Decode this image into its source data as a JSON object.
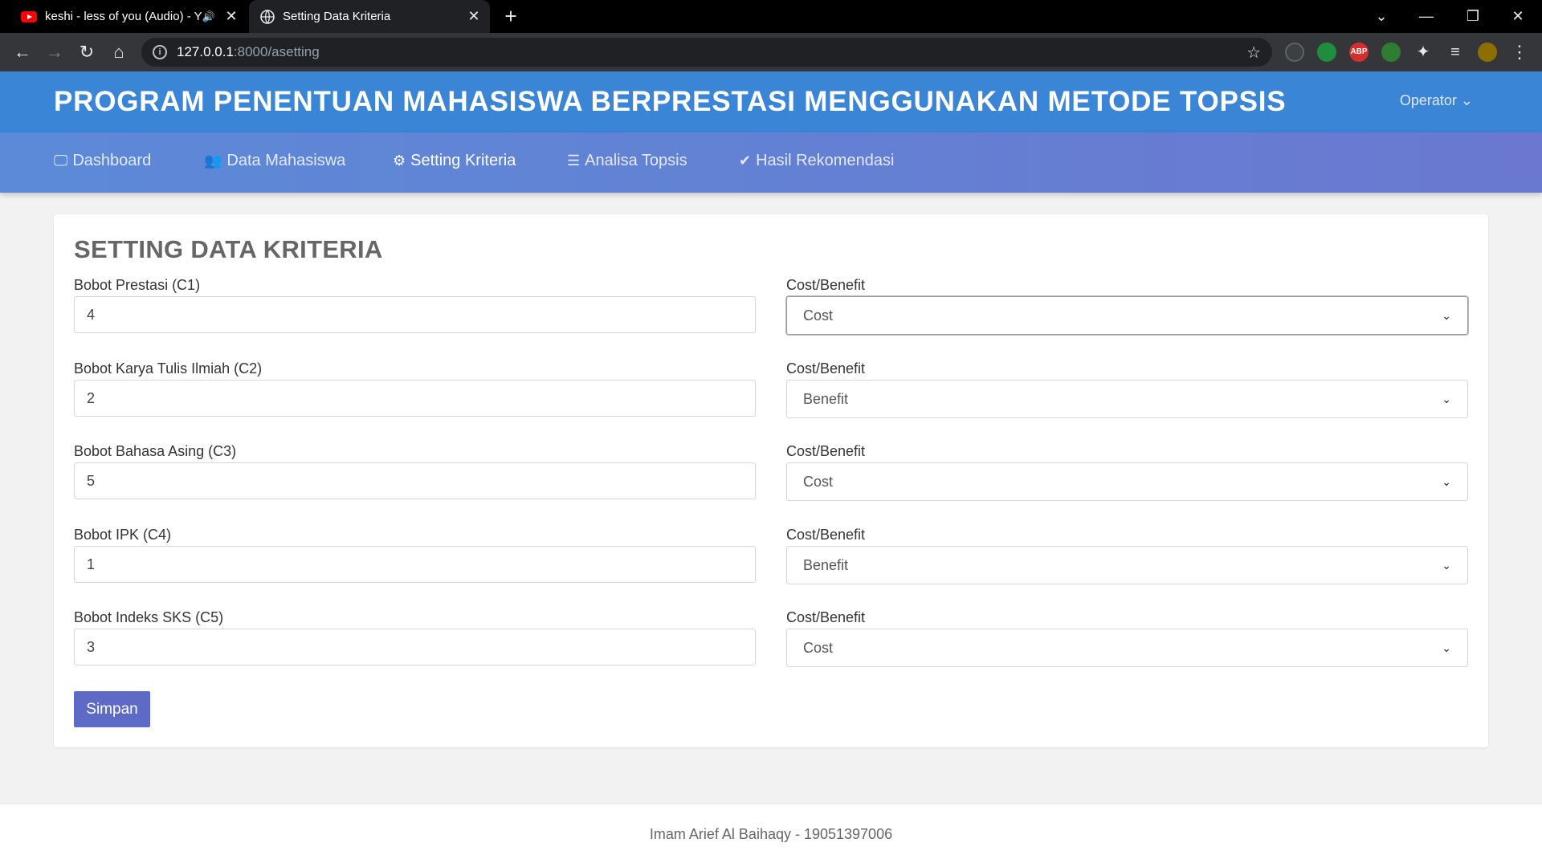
{
  "browser": {
    "tabs": [
      {
        "title": "keshi - less of you (Audio) - Y",
        "close": "✕",
        "audio": "🔊"
      },
      {
        "title": "Setting Data Kriteria",
        "close": "✕"
      }
    ],
    "new_tab": "+",
    "url_host": "127.0.0.1",
    "url_path": ":8000/asetting",
    "icons": [
      "back-icon",
      "forward-icon",
      "reload-icon",
      "home-icon",
      "info-icon",
      "star-icon",
      "extensions-icon",
      "menu-icon"
    ],
    "extensions": {
      "abp": "ABP"
    },
    "window_controls": {
      "tab_search": "⌄",
      "minimize": "—",
      "restore": "❐",
      "close": "✕"
    }
  },
  "header": {
    "title": "PROGRAM PENENTUAN MAHASISWA BERPRESTASI MENGGUNAKAN METODE TOPSIS",
    "user_menu": "Operator"
  },
  "nav": {
    "items": [
      {
        "label": "Dashboard",
        "icon": "monitor-icon"
      },
      {
        "label": "Data Mahasiswa",
        "icon": "users-icon"
      },
      {
        "label": "Setting Kriteria",
        "icon": "gear-icon",
        "active": true
      },
      {
        "label": "Analisa Topsis",
        "icon": "list-icon"
      },
      {
        "label": "Hasil Rekomendasi",
        "icon": "check-icon"
      }
    ]
  },
  "form": {
    "title": "SETTING DATA KRITERIA",
    "rows": [
      {
        "label": "Bobot Prestasi (C1)",
        "value": "4",
        "type_label": "Cost/Benefit",
        "type_value": "Cost"
      },
      {
        "label": "Bobot Karya Tulis Ilmiah (C2)",
        "value": "2",
        "type_label": "Cost/Benefit",
        "type_value": "Benefit"
      },
      {
        "label": "Bobot Bahasa Asing (C3)",
        "value": "5",
        "type_label": "Cost/Benefit",
        "type_value": "Cost"
      },
      {
        "label": "Bobot IPK (C4)",
        "value": "1",
        "type_label": "Cost/Benefit",
        "type_value": "Benefit"
      },
      {
        "label": "Bobot Indeks SKS (C5)",
        "value": "3",
        "type_label": "Cost/Benefit",
        "type_value": "Cost"
      }
    ],
    "submit": "Simpan"
  },
  "footer": {
    "text": "Imam Arief Al Baihaqy - 19051397006"
  },
  "colors": {
    "header": "#3a85d6",
    "nav": "#6a78d0",
    "button": "#5d6bc6"
  }
}
